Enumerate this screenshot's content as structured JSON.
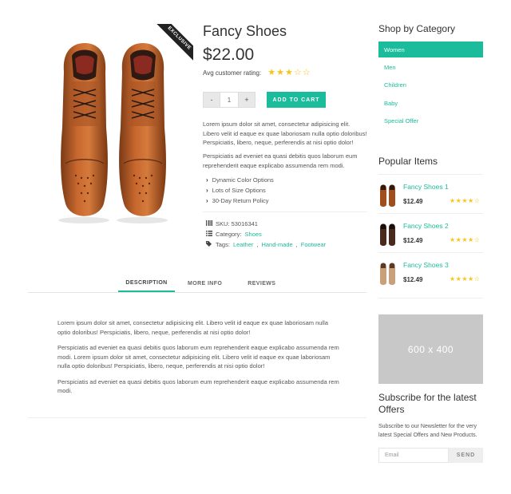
{
  "product": {
    "badge": "EXCLUSIVE",
    "title": "Fancy Shoes",
    "price": "$22.00",
    "rating_label": "Avg customer rating:",
    "rating_value": 3,
    "rating_max": 5,
    "quantity_minus": "-",
    "quantity_value": "1",
    "quantity_plus": "+",
    "add_to_cart": "ADD TO CART",
    "description_1": "Lorem ipsum dolor sit amet, consectetur adipisicing elit. Libero velit id eaque ex quae laboriosam nulla optio doloribus! Perspiciatis, libero, neque, perferendis at nisi optio dolor!",
    "description_2": "Perspiciatis ad eveniet ea quasi debitis quos laborum eum reprehenderit eaque explicabo assumenda rem modi.",
    "features": [
      {
        "icon": "chevron-right-icon",
        "label": "Dynamic Color Options"
      },
      {
        "icon": "chevron-right-icon",
        "label": "Lots of Size Options"
      },
      {
        "icon": "chevron-right-icon",
        "label": "30-Day Return Policy"
      }
    ],
    "meta": {
      "sku_label": "SKU: 53016341",
      "category_label": "Category:",
      "category_value": "Shoes",
      "tags_label": "Tags:",
      "tags": [
        "Leather",
        "Hand-made",
        "Footwear"
      ]
    }
  },
  "tabs": [
    {
      "label": "DESCRIPTION",
      "active": true
    },
    {
      "label": "MORE INFO",
      "active": false
    },
    {
      "label": "REVIEWS",
      "active": false
    }
  ],
  "tab_content": {
    "p1": "Lorem ipsum dolor sit amet, consectetur adipisicing elit. Libero velit id eaque ex quae laboriosam nulla optio doloribus! Perspiciatis, libero, neque, perferendis at nisi optio dolor!",
    "p2": "Perspiciatis ad eveniet ea quasi debitis quos laborum eum reprehenderit eaque explicabo assumenda rem modi. Lorem ipsum dolor sit amet, consectetur adipisicing elit. Libero velit id eaque ex quae laboriosam nulla optio doloribus! Perspiciatis, libero, neque, perferendis at nisi optio dolor!",
    "p3": "Perspiciatis ad eveniet ea quasi debitis quos laborum eum reprehenderit eaque explicabo assumenda rem modi."
  },
  "sidebar": {
    "category_heading": "Shop by Category",
    "categories": [
      {
        "label": "Women",
        "active": true
      },
      {
        "label": "Men",
        "active": false
      },
      {
        "label": "Children",
        "active": false
      },
      {
        "label": "Baby",
        "active": false
      },
      {
        "label": "Special Offer",
        "active": false
      }
    ],
    "popular_heading": "Popular Items",
    "popular": [
      {
        "name": "Fancy Shoes 1",
        "price": "$12.49",
        "rating": 3.5
      },
      {
        "name": "Fancy Shoes 2",
        "price": "$12.49",
        "rating": 3.5
      },
      {
        "name": "Fancy Shoes 3",
        "price": "$12.49",
        "rating": 3.5
      }
    ],
    "ad_placeholder": "600 x 400",
    "subscribe_heading": "Subscribe for the latest Offers",
    "subscribe_text": "Subscribe to our Newsletter for the very latest Special Offers and New Products.",
    "email_placeholder": "Email",
    "send_label": "SEND"
  },
  "colors": {
    "accent": "#1abc9c",
    "star": "#f5c518",
    "badge_bg": "#222222",
    "placeholder_bg": "#c8c8c8"
  }
}
